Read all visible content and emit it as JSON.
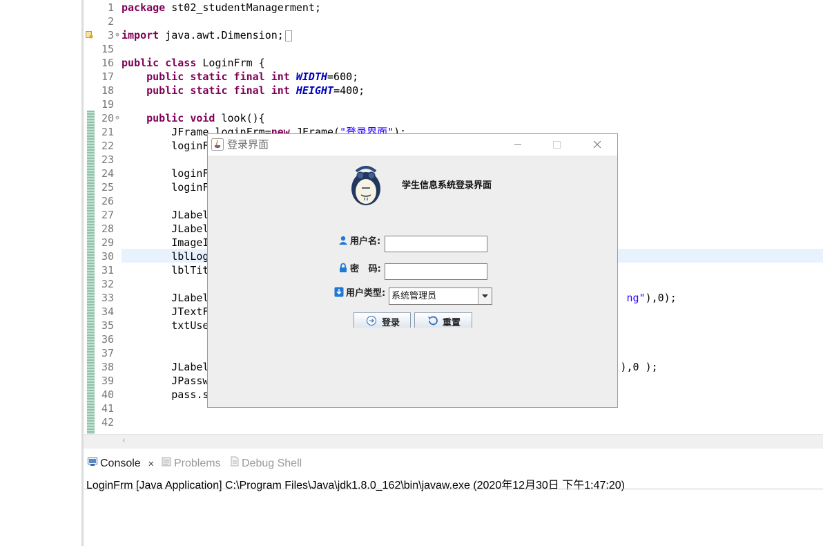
{
  "editor": {
    "lines": [
      {
        "num": "1",
        "segments": [
          {
            "t": "package",
            "c": "kw"
          },
          {
            "t": " st02_studentManagerment;"
          }
        ]
      },
      {
        "num": "2",
        "segments": []
      },
      {
        "num": "3",
        "segments": [
          {
            "t": "import",
            "c": "kw"
          },
          {
            "t": " java.awt.Dimension;"
          }
        ],
        "fold": "⊕",
        "warning": true,
        "collapsed": true
      },
      {
        "num": "15",
        "segments": []
      },
      {
        "num": "16",
        "segments": [
          {
            "t": "public class",
            "c": "kw"
          },
          {
            "t": " LoginFrm {"
          }
        ]
      },
      {
        "num": "17",
        "segments": [
          {
            "t": "    "
          },
          {
            "t": "public static final int",
            "c": "kw"
          },
          {
            "t": " "
          },
          {
            "t": "WIDTH",
            "c": "const"
          },
          {
            "t": "=600;"
          }
        ]
      },
      {
        "num": "18",
        "segments": [
          {
            "t": "    "
          },
          {
            "t": "public static final int",
            "c": "kw"
          },
          {
            "t": " "
          },
          {
            "t": "HEIGHT",
            "c": "const"
          },
          {
            "t": "=400;"
          }
        ]
      },
      {
        "num": "19",
        "segments": []
      },
      {
        "num": "20",
        "segments": [
          {
            "t": "    "
          },
          {
            "t": "public void",
            "c": "kw"
          },
          {
            "t": " look(){"
          }
        ],
        "fold": "⊖"
      },
      {
        "num": "21",
        "segments": [
          {
            "t": "        JFrame loginFrm="
          },
          {
            "t": "new",
            "c": "kw"
          },
          {
            "t": " JFrame("
          },
          {
            "t": "\"登录界面\"",
            "c": "str"
          },
          {
            "t": ");"
          }
        ]
      },
      {
        "num": "22",
        "segments": [
          {
            "t": "        loginF"
          }
        ]
      },
      {
        "num": "23",
        "segments": []
      },
      {
        "num": "24",
        "segments": [
          {
            "t": "        loginF"
          }
        ]
      },
      {
        "num": "25",
        "segments": [
          {
            "t": "        loginF"
          }
        ]
      },
      {
        "num": "26",
        "segments": []
      },
      {
        "num": "27",
        "segments": [
          {
            "t": "        JLabel"
          }
        ]
      },
      {
        "num": "28",
        "segments": [
          {
            "t": "        JLabel"
          }
        ]
      },
      {
        "num": "29",
        "segments": [
          {
            "t": "        ImageI"
          }
        ]
      },
      {
        "num": "30",
        "segments": [
          {
            "t": "        lblLog"
          }
        ]
      },
      {
        "num": "31",
        "segments": [
          {
            "t": "        lblTit"
          }
        ]
      },
      {
        "num": "32",
        "segments": []
      },
      {
        "num": "33",
        "segments": [
          {
            "t": "        JLabel"
          },
          {
            "t": "                                                                   "
          },
          {
            "t": "ng\"",
            "c": "str"
          },
          {
            "t": "),0);"
          }
        ]
      },
      {
        "num": "34",
        "segments": [
          {
            "t": "        JTextF"
          }
        ]
      },
      {
        "num": "35",
        "segments": [
          {
            "t": "        txtUse"
          }
        ]
      },
      {
        "num": "36",
        "segments": []
      },
      {
        "num": "37",
        "segments": []
      },
      {
        "num": "38",
        "segments": [
          {
            "t": "        JLabel"
          },
          {
            "t": "                                                                  ),0 );"
          }
        ]
      },
      {
        "num": "39",
        "segments": [
          {
            "t": "        JPassw"
          }
        ]
      },
      {
        "num": "40",
        "segments": [
          {
            "t": "        pass.s"
          }
        ]
      },
      {
        "num": "41",
        "segments": []
      },
      {
        "num": "42",
        "segments": []
      }
    ]
  },
  "console": {
    "tabs": [
      {
        "label": "Console",
        "icon": "console-icon",
        "active": true
      },
      {
        "label": "Problems",
        "icon": "problems-icon",
        "active": false
      },
      {
        "label": "Debug Shell",
        "icon": "debug-shell-icon",
        "active": false
      }
    ],
    "close_glyph": "✕",
    "status": "LoginFrm [Java Application] C:\\Program Files\\Java\\jdk1.8.0_162\\bin\\javaw.exe (2020年12月30日 下午1:47:20)"
  },
  "login_window": {
    "title": "登录界面",
    "app_title": "学生信息系统登录界面",
    "username_label": "用户名:",
    "username_value": "",
    "password_label": "密   码:",
    "password_value": "",
    "user_type_label": "用户类型:",
    "user_type_selected": "系统管理员",
    "login_button": "登录",
    "reset_button": "重置"
  },
  "colors": {
    "keyword": "#7f0055",
    "string": "#2a00ff",
    "constant": "#0000c0",
    "line_number": "#787878",
    "current_line": "#e8f2fe",
    "label_icon_blue": "#1e78d8"
  }
}
